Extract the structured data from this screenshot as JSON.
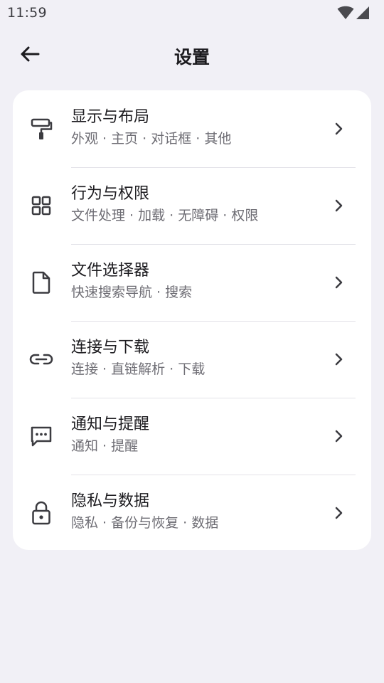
{
  "status_bar": {
    "time": "11:59",
    "icons": [
      "wifi-icon",
      "cellular-signal-icon"
    ]
  },
  "app_bar": {
    "title": "设置",
    "back_icon": "arrow-back-icon"
  },
  "colors": {
    "background": "#f1f0f6",
    "card": "#ffffff",
    "title_text": "#1c1b1f",
    "subtitle_text": "#6e6d74",
    "divider": "#e3e2e8"
  },
  "settings": {
    "items": [
      {
        "icon": "paint-roller-icon",
        "title": "显示与布局",
        "subtitle": "外观 · 主页 · 对话框 · 其他"
      },
      {
        "icon": "grid-icon",
        "title": "行为与权限",
        "subtitle": "文件处理 · 加载 · 无障碍 · 权限"
      },
      {
        "icon": "file-icon",
        "title": "文件选择器",
        "subtitle": "快速搜索导航 · 搜索"
      },
      {
        "icon": "link-icon",
        "title": "连接与下载",
        "subtitle": "连接 · 直链解析 · 下载"
      },
      {
        "icon": "message-icon",
        "title": "通知与提醒",
        "subtitle": "通知 · 提醒"
      },
      {
        "icon": "lock-icon",
        "title": "隐私与数据",
        "subtitle": "隐私 · 备份与恢复 · 数据"
      }
    ]
  }
}
